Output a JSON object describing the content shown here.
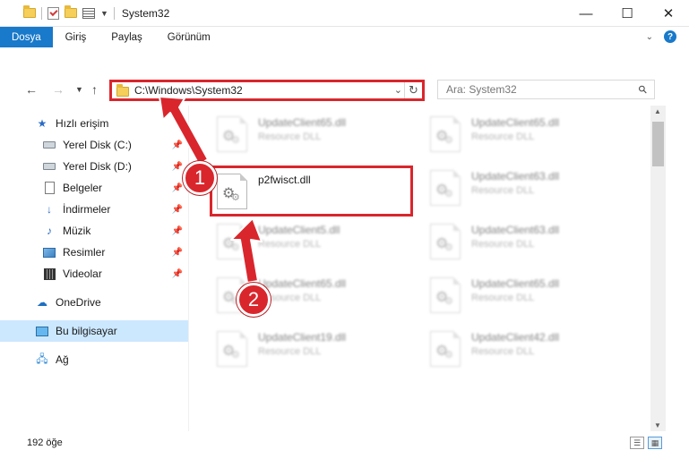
{
  "window": {
    "title": "System32"
  },
  "ribbon": {
    "tabs": [
      "Dosya",
      "Giriş",
      "Paylaş",
      "Görünüm"
    ]
  },
  "address": {
    "path": "C:\\Windows\\System32"
  },
  "search": {
    "placeholder": "Ara: System32"
  },
  "nav": {
    "quick_access": "Hızlı erişim",
    "items": [
      "Yerel Disk (C:)",
      "Yerel Disk (D:)",
      "Belgeler",
      "İndirmeler",
      "Müzik",
      "Resimler",
      "Videolar"
    ],
    "onedrive": "OneDrive",
    "this_pc": "Bu bilgisayar",
    "network": "Ağ"
  },
  "files": {
    "left": [
      {
        "name": "UpdateClient65.dll",
        "type": "Resource DLL"
      },
      {
        "name": "p2fwisct.dll",
        "type": ""
      },
      {
        "name": "UpdateClient5.dll",
        "type": "Resource DLL"
      },
      {
        "name": "UpdateClient65.dll",
        "type": "Resource DLL"
      },
      {
        "name": "UpdateClient19.dll",
        "type": "Resource DLL"
      }
    ],
    "right": [
      {
        "name": "UpdateClient65.dll",
        "type": "Resource DLL"
      },
      {
        "name": "UpdateClient63.dll",
        "type": "Resource DLL"
      },
      {
        "name": "UpdateClient63.dll",
        "type": "Resource DLL"
      },
      {
        "name": "UpdateClient65.dll",
        "type": "Resource DLL"
      },
      {
        "name": "UpdateClient42.dll",
        "type": "Resource DLL"
      }
    ]
  },
  "status": {
    "count": "192 öğe"
  },
  "annotations": {
    "step1": "1",
    "step2": "2",
    "color": "#d9262c"
  }
}
